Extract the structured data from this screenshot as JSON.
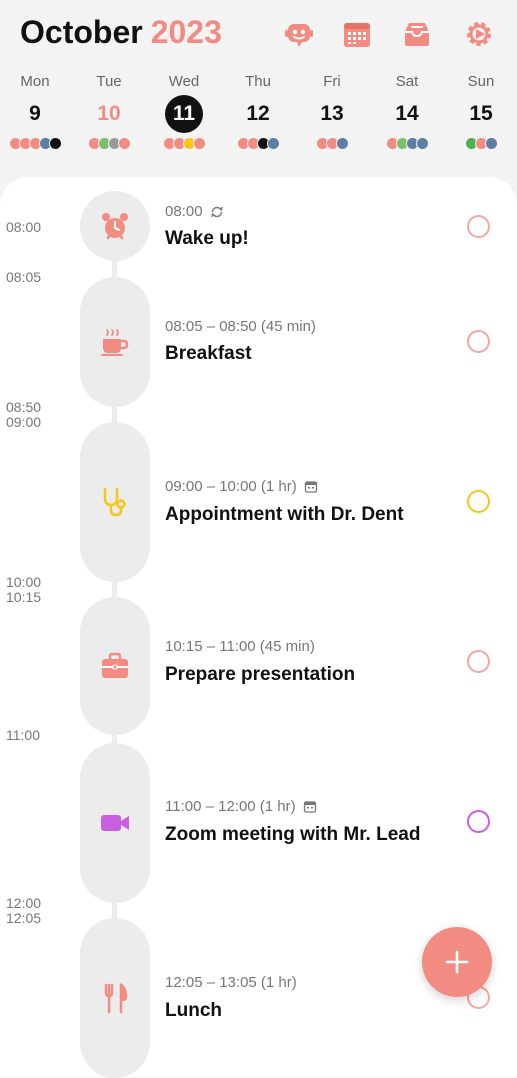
{
  "header": {
    "month": "October",
    "year": "2023",
    "icons": [
      "assistant-robot-icon",
      "calendar-icon",
      "inbox-icon",
      "settings-gear-icon"
    ],
    "accent_color": "#f28b82"
  },
  "week": [
    {
      "name": "Mon",
      "num": "9",
      "state": "normal",
      "dots": [
        "#f28b82",
        "#f28b82",
        "#f28b82",
        "#5d7fa3",
        "#111111"
      ]
    },
    {
      "name": "Tue",
      "num": "10",
      "state": "today",
      "dots": [
        "#f28b82",
        "#7cbf6a",
        "#9a9a9a",
        "#f28b82"
      ]
    },
    {
      "name": "Wed",
      "num": "11",
      "state": "selected",
      "dots": [
        "#f28b82",
        "#f28b82",
        "#f5c518",
        "#f28b82"
      ]
    },
    {
      "name": "Thu",
      "num": "12",
      "state": "normal",
      "dots": [
        "#f28b82",
        "#f28b82",
        "#111111",
        "#5d7fa3"
      ]
    },
    {
      "name": "Fri",
      "num": "13",
      "state": "normal",
      "dots": [
        "#f28b82",
        "#f28b82",
        "#5d7fa3"
      ]
    },
    {
      "name": "Sat",
      "num": "14",
      "state": "normal",
      "dots": [
        "#f28b82",
        "#7cbf6a",
        "#5d7fa3",
        "#5d7fa3"
      ]
    },
    {
      "name": "Sun",
      "num": "15",
      "state": "normal",
      "dots": [
        "#4caf50",
        "#f28b82",
        "#5d7fa3"
      ]
    }
  ],
  "time_labels": [
    "08:00",
    "08:05",
    "08:50",
    "09:00",
    "10:00",
    "10:15",
    "11:00",
    "12:00",
    "12:05"
  ],
  "tasks": [
    {
      "time": "08:00",
      "title": "Wake up!",
      "icon": "alarm-clock-icon",
      "extra": "repeat-icon",
      "color": "#f28b82"
    },
    {
      "time": "08:05 – 08:50 (45 min)",
      "title": "Breakfast",
      "icon": "coffee-cup-icon",
      "extra": "",
      "color": "#f28b82"
    },
    {
      "time": "09:00 – 10:00 (1 hr)",
      "title": "Appointment with Dr. Dent",
      "icon": "stethoscope-icon",
      "extra": "calendar-mini-icon",
      "color": "#f5c518"
    },
    {
      "time": "10:15 – 11:00 (45 min)",
      "title": "Prepare presentation",
      "icon": "briefcase-icon",
      "extra": "",
      "color": "#f28b82"
    },
    {
      "time": "11:00 – 12:00 (1 hr)",
      "title": "Zoom meeting with Mr. Lead",
      "icon": "video-camera-icon",
      "extra": "calendar-mini-icon",
      "color": "#c95fe0"
    },
    {
      "time": "12:05 – 13:05 (1 hr)",
      "title": "Lunch",
      "icon": "fork-knife-icon",
      "extra": "",
      "color": "#f28b82"
    }
  ],
  "fab": {
    "icon": "plus-icon"
  }
}
